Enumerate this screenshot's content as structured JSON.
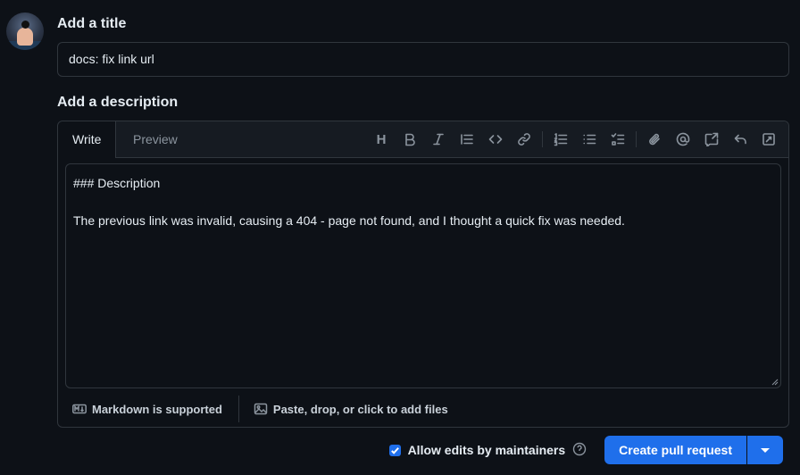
{
  "title_section": {
    "label": "Add a title",
    "value": "docs: fix link url"
  },
  "description_section": {
    "label": "Add a description",
    "tabs": [
      "Write",
      "Preview"
    ],
    "active_tab": "Write",
    "toolbar_icons": [
      "heading-icon",
      "bold-icon",
      "italic-icon",
      "quote-icon",
      "code-icon",
      "link-icon",
      "ordered-list-icon",
      "unordered-list-icon",
      "task-list-icon",
      "attach-icon",
      "mention-icon",
      "reference-icon",
      "reply-icon",
      "fullscreen-icon"
    ],
    "heading_glyph": "H",
    "body_lines": [
      "### Description",
      "",
      "The previous link was invalid, causing a 404 - page not found, and I thought a quick fix was needed."
    ],
    "markdown_note": "Markdown is supported",
    "attach_note": "Paste, drop, or click to add files"
  },
  "actions": {
    "allow_edits_label": "Allow edits by maintainers",
    "allow_edits_checked": true,
    "create_button": "Create pull request"
  },
  "colors": {
    "background": "#0d1117",
    "accent": "#1f6feb",
    "border": "#30363d"
  }
}
